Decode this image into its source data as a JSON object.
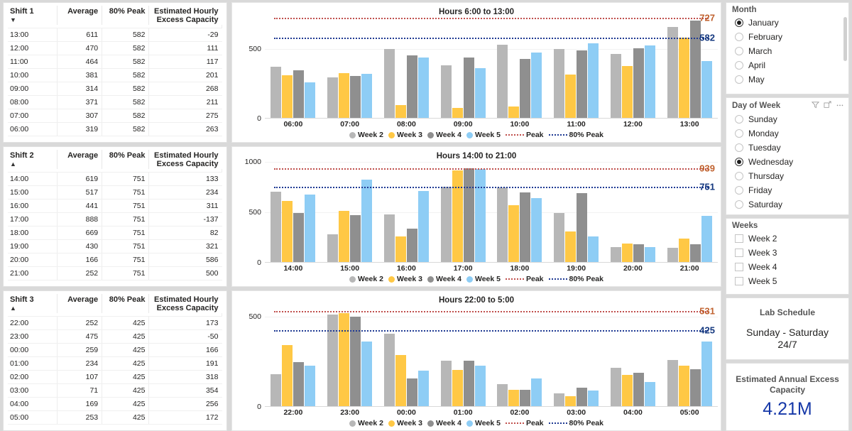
{
  "colors": {
    "week2": "#b7b7b7",
    "week3": "#ffc845",
    "week4": "#8f8f8f",
    "week5": "#8ecdf5",
    "peak_line": "#c0504d",
    "peak80_line": "#1f3a93",
    "peak_label": "#c0622f",
    "peak80_label": "#14387f",
    "kpi_value": "#1638a8"
  },
  "tables": [
    {
      "name": "shift-1-table",
      "headers": [
        "Shift 1",
        "Average",
        "80% Peak",
        "Estimated Hourly Excess Capacity"
      ],
      "sort_indicator": "▼",
      "rows": [
        [
          "13:00",
          "611",
          "582",
          "-29"
        ],
        [
          "12:00",
          "470",
          "582",
          "111"
        ],
        [
          "11:00",
          "464",
          "582",
          "117"
        ],
        [
          "10:00",
          "381",
          "582",
          "201"
        ],
        [
          "09:00",
          "314",
          "582",
          "268"
        ],
        [
          "08:00",
          "371",
          "582",
          "211"
        ],
        [
          "07:00",
          "307",
          "582",
          "275"
        ],
        [
          "06:00",
          "319",
          "582",
          "263"
        ]
      ]
    },
    {
      "name": "shift-2-table",
      "headers": [
        "Shift 2",
        "Average",
        "80% Peak",
        "Estimated Hourly Excess Capacity"
      ],
      "sort_indicator": "▲",
      "rows": [
        [
          "14:00",
          "619",
          "751",
          "133"
        ],
        [
          "15:00",
          "517",
          "751",
          "234"
        ],
        [
          "16:00",
          "441",
          "751",
          "311"
        ],
        [
          "17:00",
          "888",
          "751",
          "-137"
        ],
        [
          "18:00",
          "669",
          "751",
          "82"
        ],
        [
          "19:00",
          "430",
          "751",
          "321"
        ],
        [
          "20:00",
          "166",
          "751",
          "586"
        ],
        [
          "21:00",
          "252",
          "751",
          "500"
        ]
      ]
    },
    {
      "name": "shift-3-table",
      "headers": [
        "Shift 3",
        "Average",
        "80% Peak",
        "Estimated Hourly Excess Capacity"
      ],
      "sort_indicator": "▲",
      "rows": [
        [
          "22:00",
          "252",
          "425",
          "173"
        ],
        [
          "23:00",
          "475",
          "425",
          "-50"
        ],
        [
          "00:00",
          "259",
          "425",
          "166"
        ],
        [
          "01:00",
          "234",
          "425",
          "191"
        ],
        [
          "02:00",
          "107",
          "425",
          "318"
        ],
        [
          "03:00",
          "71",
          "425",
          "354"
        ],
        [
          "04:00",
          "169",
          "425",
          "256"
        ],
        [
          "05:00",
          "253",
          "425",
          "172"
        ]
      ]
    }
  ],
  "chart_data": [
    {
      "type": "bar",
      "name": "chart-shift-1",
      "title": "Hours 6:00 to 13:00",
      "xlabel": "",
      "ylabel": "",
      "ylim": [
        0,
        727
      ],
      "yticks": [
        0,
        500
      ],
      "ytick_labels": [
        "0",
        "500"
      ],
      "grid": true,
      "legend_position": "bottom",
      "categories": [
        "06:00",
        "07:00",
        "08:00",
        "09:00",
        "10:00",
        "11:00",
        "12:00",
        "13:00"
      ],
      "series": [
        {
          "name": "Week 2",
          "color": "#b7b7b7",
          "values": [
            370,
            292,
            502,
            381,
            533,
            500,
            463,
            662
          ]
        },
        {
          "name": "Week 3",
          "color": "#ffc845",
          "values": [
            311,
            325,
            93,
            71,
            83,
            317,
            374,
            583
          ]
        },
        {
          "name": "Week 4",
          "color": "#8f8f8f",
          "values": [
            345,
            303,
            452,
            437,
            427,
            492,
            505,
            707
          ]
        },
        {
          "name": "Week 5",
          "color": "#8ecdf5",
          "values": [
            256,
            322,
            437,
            361,
            477,
            543,
            528,
            410
          ]
        }
      ],
      "reference_lines": [
        {
          "name": "Peak",
          "value": 727,
          "label": "727",
          "color": "#c0504d",
          "style": "dotted"
        },
        {
          "name": "80% Peak",
          "value": 582,
          "label": "582",
          "color": "#1f3a93",
          "style": "dotted"
        }
      ],
      "legend": [
        "Week 2",
        "Week 3",
        "Week 4",
        "Week 5",
        "Peak",
        "80% Peak"
      ]
    },
    {
      "type": "bar",
      "name": "chart-shift-2",
      "title": "Hours 14:00 to 21:00",
      "xlabel": "",
      "ylabel": "",
      "ylim": [
        0,
        1000
      ],
      "yticks": [
        0,
        500,
        1000
      ],
      "ytick_labels": [
        "0",
        "500",
        "1000"
      ],
      "grid": true,
      "legend_position": "bottom",
      "categories": [
        "14:00",
        "15:00",
        "16:00",
        "17:00",
        "18:00",
        "19:00",
        "20:00",
        "21:00"
      ],
      "series": [
        {
          "name": "Week 2",
          "color": "#b7b7b7",
          "values": [
            700,
            275,
            478,
            752,
            742,
            487,
            147,
            141
          ]
        },
        {
          "name": "Week 3",
          "color": "#ffc845",
          "values": [
            608,
            508,
            258,
            916,
            568,
            302,
            188,
            232
          ]
        },
        {
          "name": "Week 4",
          "color": "#8f8f8f",
          "values": [
            487,
            468,
            332,
            934,
            692,
            688,
            174,
            176
          ]
        },
        {
          "name": "Week 5",
          "color": "#8ecdf5",
          "values": [
            672,
            822,
            706,
            932,
            641,
            252,
            150,
            459
          ]
        }
      ],
      "reference_lines": [
        {
          "name": "Peak",
          "value": 939,
          "label": "939",
          "color": "#c0504d",
          "style": "dotted"
        },
        {
          "name": "80% Peak",
          "value": 751,
          "label": "751",
          "color": "#1f3a93",
          "style": "dotted"
        }
      ],
      "legend": [
        "Week 2",
        "Week 3",
        "Week 4",
        "Week 5",
        "Peak",
        "80% Peak"
      ]
    },
    {
      "type": "bar",
      "name": "chart-shift-3",
      "title": "Hours 22:00 to 5:00",
      "xlabel": "",
      "ylabel": "",
      "ylim": [
        0,
        560
      ],
      "yticks": [
        0,
        500
      ],
      "ytick_labels": [
        "0",
        "500"
      ],
      "grid": true,
      "legend_position": "bottom",
      "categories": [
        "22:00",
        "23:00",
        "00:00",
        "01:00",
        "02:00",
        "03:00",
        "04:00",
        "05:00"
      ],
      "series": [
        {
          "name": "Week 2",
          "color": "#b7b7b7",
          "values": [
            180,
            514,
            405,
            256,
            122,
            71,
            216,
            260
          ]
        },
        {
          "name": "Week 3",
          "color": "#ffc845",
          "values": [
            342,
            521,
            288,
            203,
            92,
            57,
            175,
            227
          ]
        },
        {
          "name": "Week 4",
          "color": "#8f8f8f",
          "values": [
            248,
            500,
            155,
            253,
            90,
            103,
            186,
            207
          ]
        },
        {
          "name": "Week 5",
          "color": "#8ecdf5",
          "values": [
            228,
            360,
            198,
            225,
            153,
            86,
            136,
            362
          ]
        }
      ],
      "reference_lines": [
        {
          "name": "Peak",
          "value": 531,
          "label": "531",
          "color": "#c0504d",
          "style": "dotted"
        },
        {
          "name": "80% Peak",
          "value": 425,
          "label": "425",
          "color": "#1f3a93",
          "style": "dotted"
        }
      ],
      "legend": [
        "Week 2",
        "Week 3",
        "Week 4",
        "Week 5",
        "Peak",
        "80% Peak"
      ]
    }
  ],
  "slicers": {
    "month": {
      "title": "Month",
      "type": "radio",
      "items": [
        {
          "label": "January",
          "selected": true
        },
        {
          "label": "February",
          "selected": false
        },
        {
          "label": "March",
          "selected": false
        },
        {
          "label": "April",
          "selected": false
        },
        {
          "label": "May",
          "selected": false
        }
      ]
    },
    "day_of_week": {
      "title": "Day of Week",
      "type": "radio",
      "actions": [
        "filter-icon",
        "focus-mode-icon",
        "more-options-icon"
      ],
      "items": [
        {
          "label": "Sunday",
          "selected": false
        },
        {
          "label": "Monday",
          "selected": false
        },
        {
          "label": "Tuesday",
          "selected": false
        },
        {
          "label": "Wednesday",
          "selected": true
        },
        {
          "label": "Thursday",
          "selected": false
        },
        {
          "label": "Friday",
          "selected": false
        },
        {
          "label": "Saturday",
          "selected": false
        }
      ]
    },
    "weeks": {
      "title": "Weeks",
      "type": "checkbox",
      "items": [
        {
          "label": "Week 2",
          "selected": false
        },
        {
          "label": "Week 3",
          "selected": false
        },
        {
          "label": "Week 4",
          "selected": false
        },
        {
          "label": "Week 5",
          "selected": false
        }
      ]
    }
  },
  "cards": {
    "lab_schedule": {
      "title": "Lab Schedule",
      "line1": "Sunday - Saturday",
      "line2": "24/7"
    },
    "annual_capacity": {
      "title": "Estimated Annual Excess Capacity",
      "value": "4.21M"
    }
  }
}
